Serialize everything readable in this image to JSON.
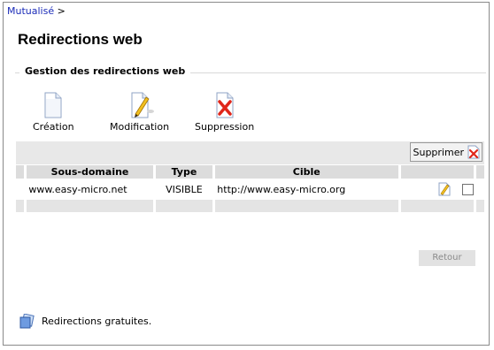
{
  "breadcrumb": {
    "link": "Mutualisé",
    "separator": ">"
  },
  "page": {
    "title": "Redirections web"
  },
  "section": {
    "title": "Gestion des redirections web"
  },
  "actions": [
    {
      "label": "Création",
      "icon": "new-document-icon"
    },
    {
      "label": "Modification",
      "icon": "edit-document-icon"
    },
    {
      "label": "Suppression",
      "icon": "delete-document-icon"
    }
  ],
  "toolbar": {
    "delete_label": "Supprimer"
  },
  "table": {
    "headers": [
      "Sous-domaine",
      "Type",
      "Cible"
    ],
    "rows": [
      {
        "subdomain": "www.easy-micro.net",
        "type": "VISIBLE",
        "target": "http://www.easy-micro.org"
      }
    ]
  },
  "buttons": {
    "back": "Retour"
  },
  "footer": {
    "free_label": "Redirections gratuites."
  },
  "colors": {
    "link": "#1a2bb8",
    "delete_red": "#e0261a"
  }
}
